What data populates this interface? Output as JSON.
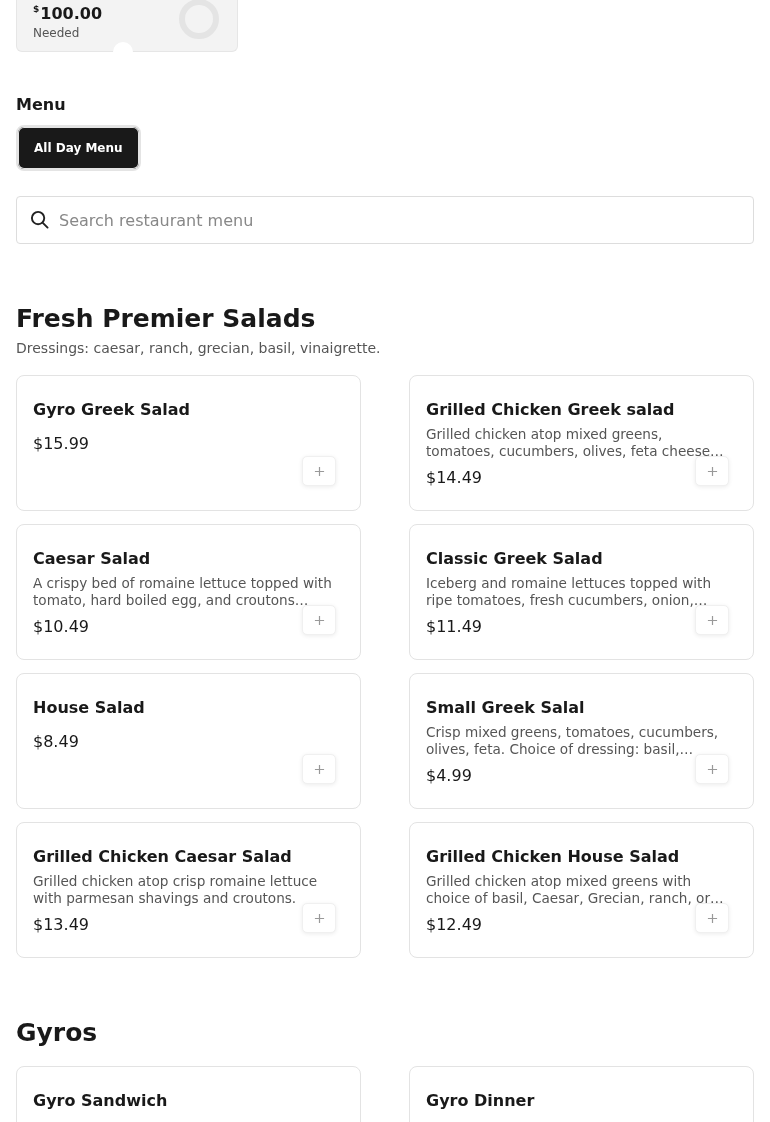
{
  "goal_card": {
    "currency": "$",
    "amount": "100.00",
    "label": "Needed"
  },
  "menu": {
    "title": "Menu",
    "tabs": [
      {
        "label": "All Day Menu",
        "selected": true
      }
    ]
  },
  "search": {
    "placeholder": "Search restaurant menu"
  },
  "sections": [
    {
      "title": "Fresh Premier Salads",
      "subtitle": "Dressings: caesar, ranch, grecian, basil, vinaigrette.",
      "items": [
        {
          "name": "Gyro Greek Salad",
          "price": "$15.99"
        },
        {
          "name": "Grilled Chicken Greek salad",
          "description": "Grilled chicken atop mixed greens, tomatoes, cucumbers, olives, feta cheese…",
          "price": "$14.49"
        },
        {
          "name": "Caesar Salad",
          "description": "A crispy bed of romaine lettuce topped with tomato, hard boiled egg, and croutons…",
          "price": "$10.49"
        },
        {
          "name": "Classic Greek Salad",
          "description": "Iceberg and romaine lettuces topped with ripe tomatoes, fresh cucumbers, onion,…",
          "price": "$11.49"
        },
        {
          "name": "House Salad",
          "price": "$8.49"
        },
        {
          "name": "Small Greek Salal",
          "description": "Crisp mixed greens, tomatoes, cucumbers, olives, feta. Choice of dressing: basil,…",
          "price": "$4.99"
        },
        {
          "name": "Grilled Chicken Caesar Salad",
          "description": "Grilled chicken atop crisp romaine lettuce with parmesan shavings and croutons.",
          "price": "$13.49"
        },
        {
          "name": "Grilled Chicken House Salad",
          "description": "Grilled chicken atop mixed greens with choice of basil, Caesar, Grecian, ranch, or…",
          "price": "$12.49"
        }
      ]
    },
    {
      "title": "Gyros",
      "items": [
        {
          "name": "Gyro Sandwich"
        },
        {
          "name": "Gyro Dinner"
        }
      ]
    }
  ]
}
